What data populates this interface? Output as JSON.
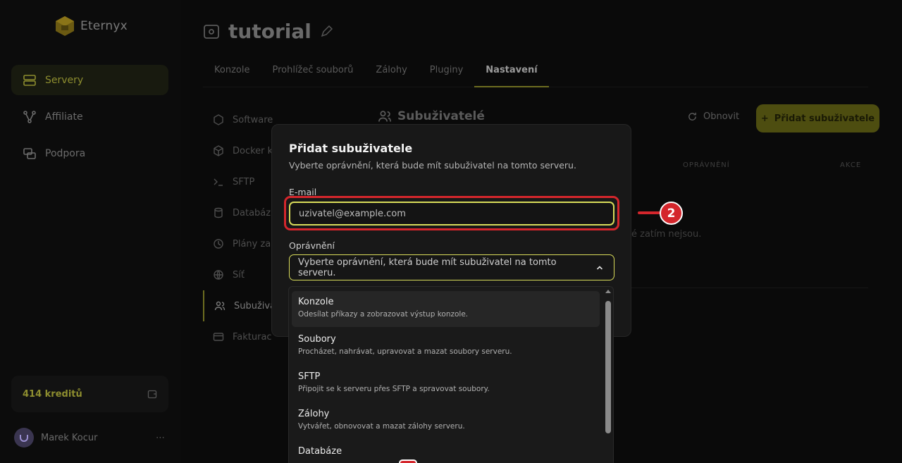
{
  "app": {
    "brand": "Eternyx",
    "accent": "#d9dc5a",
    "callout_color": "#d4262c"
  },
  "sidebar": {
    "items": [
      {
        "label": "Servery",
        "icon": "server-icon",
        "active": true
      },
      {
        "label": "Affiliate",
        "icon": "affiliate-icon",
        "active": false
      },
      {
        "label": "Podpora",
        "icon": "support-icon",
        "active": false
      }
    ],
    "credits": "414 kreditů",
    "user": "Marek Kocur",
    "user_menu": "⋯"
  },
  "server": {
    "title": "tutorial"
  },
  "tabs": [
    {
      "label": "Konzole",
      "active": false
    },
    {
      "label": "Prohlížeč souborů",
      "active": false
    },
    {
      "label": "Zálohy",
      "active": false
    },
    {
      "label": "Pluginy",
      "active": false
    },
    {
      "label": "Nastavení",
      "active": true
    }
  ],
  "subnav": [
    {
      "label": "Software",
      "icon": "cube-icon"
    },
    {
      "label": "Docker k",
      "icon": "docker-icon"
    },
    {
      "label": "SFTP",
      "icon": "terminal-icon"
    },
    {
      "label": "Databáz",
      "icon": "database-icon"
    },
    {
      "label": "Plány za",
      "icon": "clock-icon"
    },
    {
      "label": "Síť",
      "icon": "globe-icon"
    },
    {
      "label": "Subuživa",
      "icon": "users-icon",
      "active": true
    },
    {
      "label": "Fakturac",
      "icon": "card-icon"
    }
  ],
  "section": {
    "title": "Subuživatelé",
    "refresh_label": "Obnovit",
    "add_label": "Přidat subuživatele",
    "col_permissions": "OPRÁVNĚNÍ",
    "col_actions": "AKCE",
    "empty_text": "é zatím nejsou."
  },
  "modal": {
    "title": "Přidat subuživatele",
    "description": "Vyberte oprávnění, která bude mít subuživatel na tomto serveru.",
    "email_label": "E-mail",
    "email_placeholder": "uzivatel@example.com",
    "email_value": "",
    "permissions_label": "Oprávnění",
    "permissions_placeholder": "Vyberte oprávnění, která bude mít subuživatel na tomto serveru."
  },
  "callout": {
    "number": "2"
  },
  "dropdown": {
    "options": [
      {
        "title": "Konzole",
        "desc": "Odesílat příkazy a zobrazovat výstup konzole."
      },
      {
        "title": "Soubory",
        "desc": "Procházet, nahrávat, upravovat a mazat soubory serveru."
      },
      {
        "title": "SFTP",
        "desc": "Připojit se k serveru přes SFTP a spravovat soubory."
      },
      {
        "title": "Zálohy",
        "desc": "Vytvářet, obnovovat a mazat zálohy serveru."
      },
      {
        "title": "Databáze",
        "desc": ""
      }
    ]
  }
}
